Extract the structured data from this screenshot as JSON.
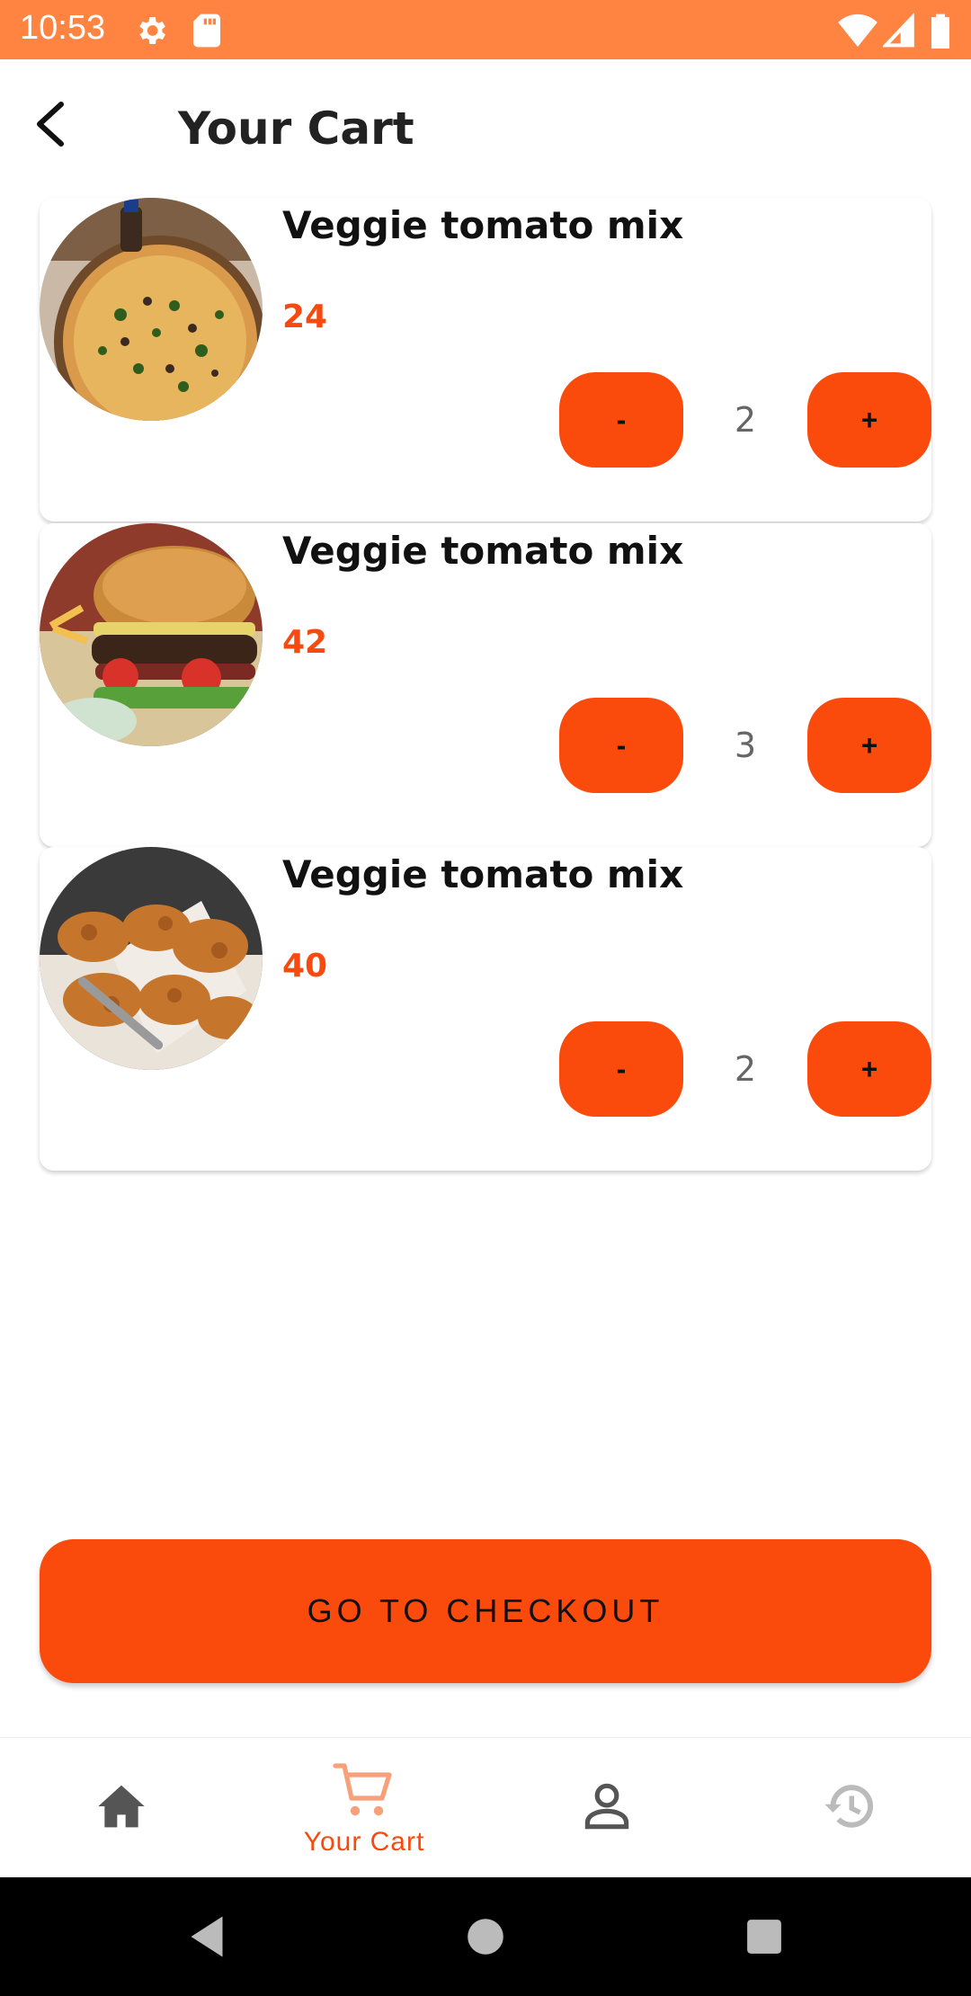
{
  "status_bar": {
    "time": "10:53",
    "icons": [
      "gear-icon",
      "sd-card-icon",
      "wifi-icon",
      "signal-icon",
      "battery-icon"
    ]
  },
  "app_bar": {
    "title": "Your Cart",
    "back_icon": "arrow-back-icon"
  },
  "cart": {
    "items": [
      {
        "name": "Veggie tomato mix",
        "price": "24",
        "quantity": "2",
        "minus_label": "-",
        "plus_label": "+",
        "image": "pizza"
      },
      {
        "name": "Veggie tomato mix",
        "price": "42",
        "quantity": "3",
        "minus_label": "-",
        "plus_label": "+",
        "image": "burger"
      },
      {
        "name": "Veggie tomato mix",
        "price": "40",
        "quantity": "2",
        "minus_label": "-",
        "plus_label": "+",
        "image": "fried-chicken"
      }
    ]
  },
  "checkout": {
    "label": "GO TO CHECKOUT"
  },
  "bottom_nav": {
    "items": [
      {
        "icon": "home-icon",
        "label": "",
        "active": false
      },
      {
        "icon": "cart-icon",
        "label": "Your Cart",
        "active": true
      },
      {
        "icon": "person-icon",
        "label": "",
        "active": false
      },
      {
        "icon": "history-icon",
        "label": "",
        "active": false
      }
    ]
  },
  "colors": {
    "status_bar": "#FF8442",
    "accent": "#FA4A0C",
    "price": "#F64A10",
    "nav_inactive": "#555555",
    "nav_history": "#BBBBBB"
  }
}
